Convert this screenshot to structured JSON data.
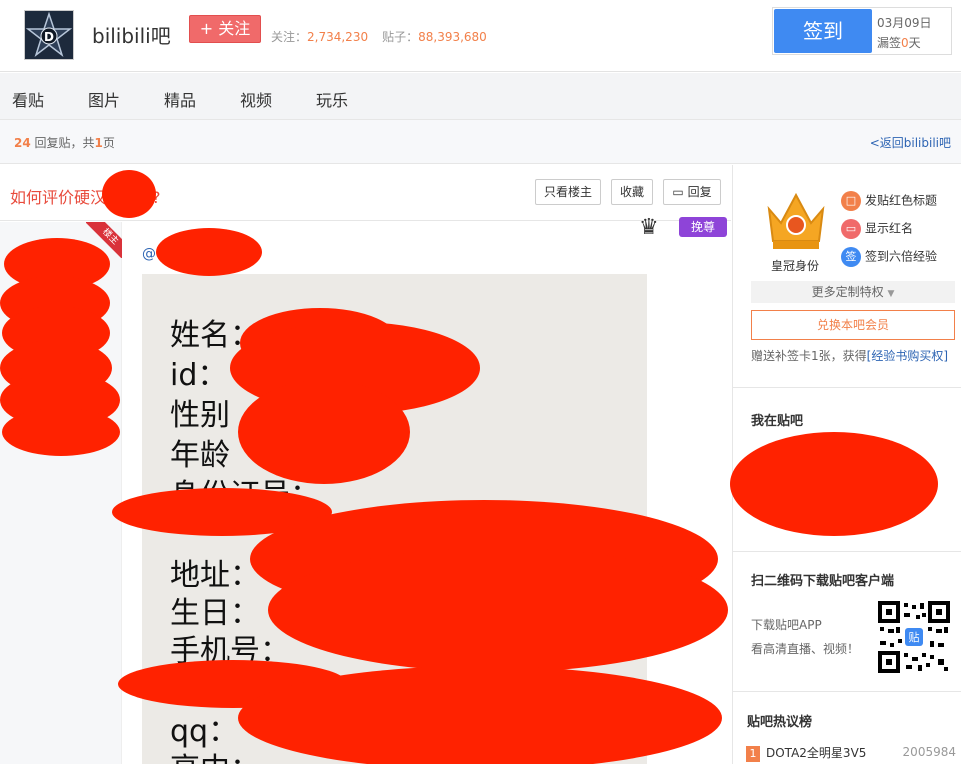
{
  "header": {
    "forum_name": "bilibili吧",
    "follow_label": "+ 关注",
    "followers_label": "关注：",
    "followers_count": "2,734,230",
    "posts_label": "贴子：",
    "posts_count": "88,393,680",
    "signin_label": "签到",
    "signin_date": "03月09日",
    "missed_prefix": "漏签",
    "missed_days": "0",
    "missed_suffix": "天"
  },
  "nav": {
    "items": [
      "看贴",
      "图片",
      "精品",
      "视频",
      "玩乐"
    ]
  },
  "reply_bar": {
    "reply_count": "24",
    "reply_text": " 回复贴，共",
    "page_count": "1",
    "page_suffix": "页",
    "back_link": "<返回bilibili吧"
  },
  "thread": {
    "title": "如何评价硬汉",
    "title_tail": "?",
    "only_op_label": "只看楼主",
    "favorite_label": "收藏",
    "reply_label": "回复",
    "op_ribbon": "楼主",
    "at_symbol": "@",
    "badge_label": "挽尊"
  },
  "post_image_lines": [
    "姓名：",
    "id：",
    "性别",
    "年龄",
    "身份证号：",
    "",
    "地址：",
    "生日：",
    "手机号：",
    "",
    "qq：",
    "高中："
  ],
  "sidebar": {
    "crown_label": "皇冠身份",
    "perks": [
      {
        "icon": "red-title-icon",
        "label": "发贴红色标题",
        "color": "#f2804a"
      },
      {
        "icon": "red-name-icon",
        "label": "显示红名",
        "color": "#f06a6a"
      },
      {
        "icon": "six-exp-icon",
        "label": "签到六倍经验",
        "color": "#3f8af2"
      }
    ],
    "perk_glyphs": [
      "□",
      "▭",
      "签"
    ],
    "more_perks": "更多定制特权",
    "exchange_label": "兑换本吧会员",
    "gift_text": "赠送补签卡1张，获得",
    "gift_link": "[经验书购买权]",
    "my_forum_title": "我在贴吧",
    "qr_title": "扫二维码下载贴吧客户端",
    "app_line1": "下载贴吧APP",
    "app_line2": "看高清直播、视频！",
    "qr_badge": "贴",
    "hot_title": "贴吧热议榜",
    "hot_items": [
      {
        "rank": "1",
        "title": "DOTA2全明星3V5",
        "count": "2005984"
      }
    ]
  },
  "colors": {
    "accent": "#3f8af2",
    "follow": "#f06a6a",
    "highlight": "#f2804a",
    "title_red": "#e84b3c",
    "redaction": "#ff2200"
  }
}
